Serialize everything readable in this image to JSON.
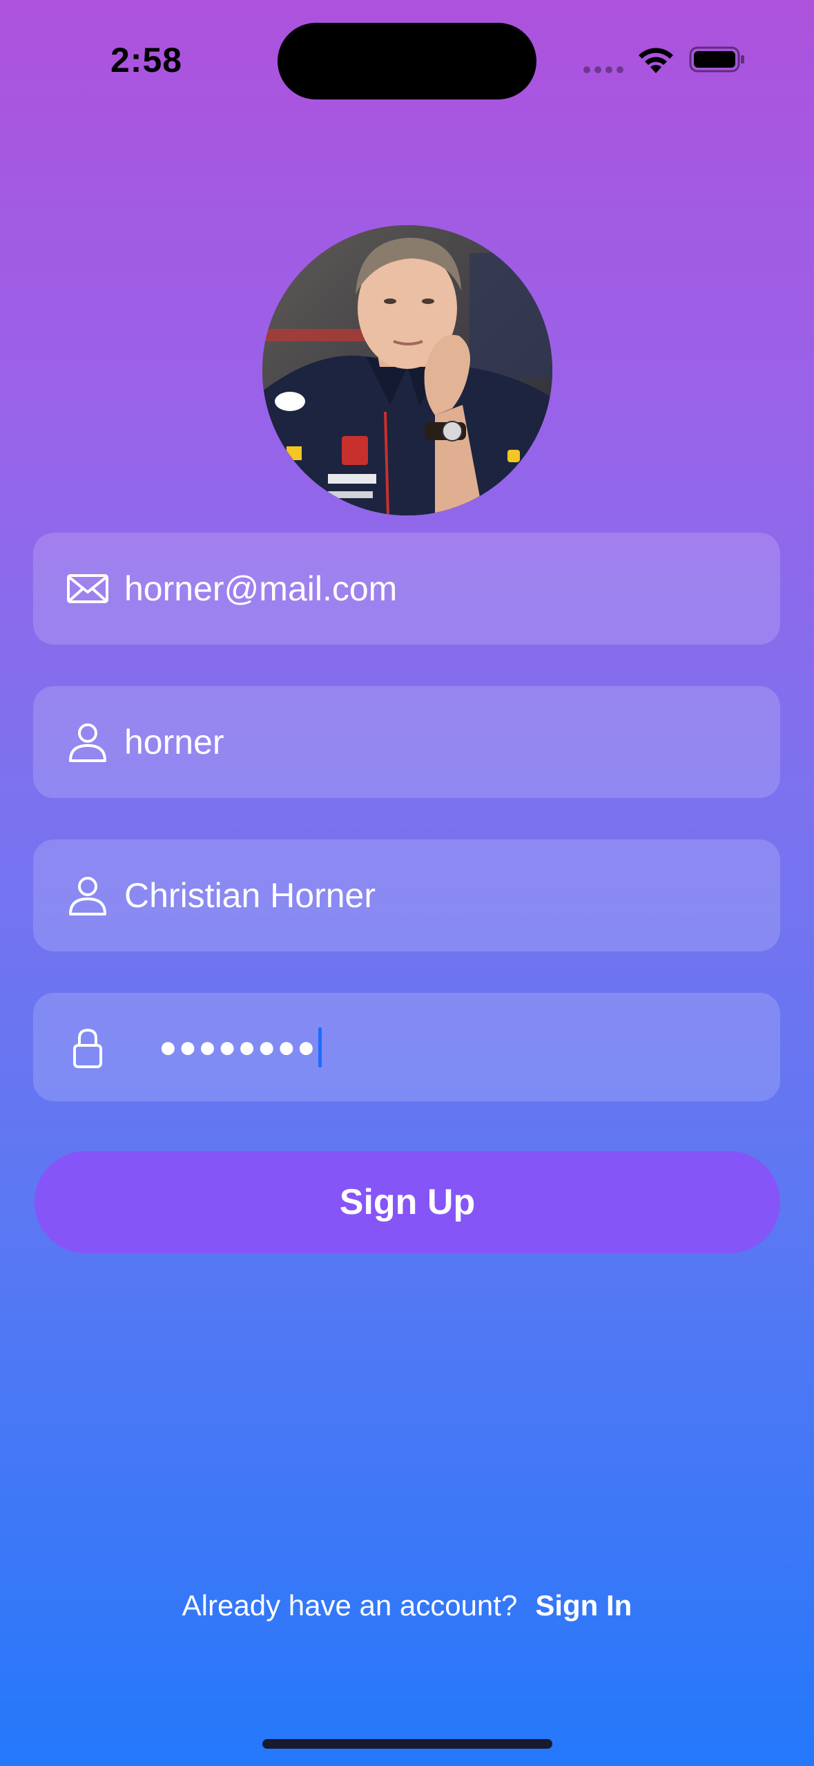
{
  "status_bar": {
    "time": "2:58"
  },
  "icons": {
    "email": "envelope-icon",
    "username": "person-icon",
    "fullname": "person-icon",
    "password": "lock-icon"
  },
  "form": {
    "email_value": "horner@mail.com",
    "username_value": "horner",
    "fullname_value": "Christian Horner",
    "password_mask": "●●●●●●●●"
  },
  "signup_button_label": "Sign Up",
  "footer": {
    "prompt": "Already have an account?",
    "signin_label": "Sign In"
  },
  "colors": {
    "gradient_top": "#ad52dd",
    "gradient_bottom": "#2478fb",
    "button": "#8655f7",
    "caret": "#1e6cff"
  }
}
